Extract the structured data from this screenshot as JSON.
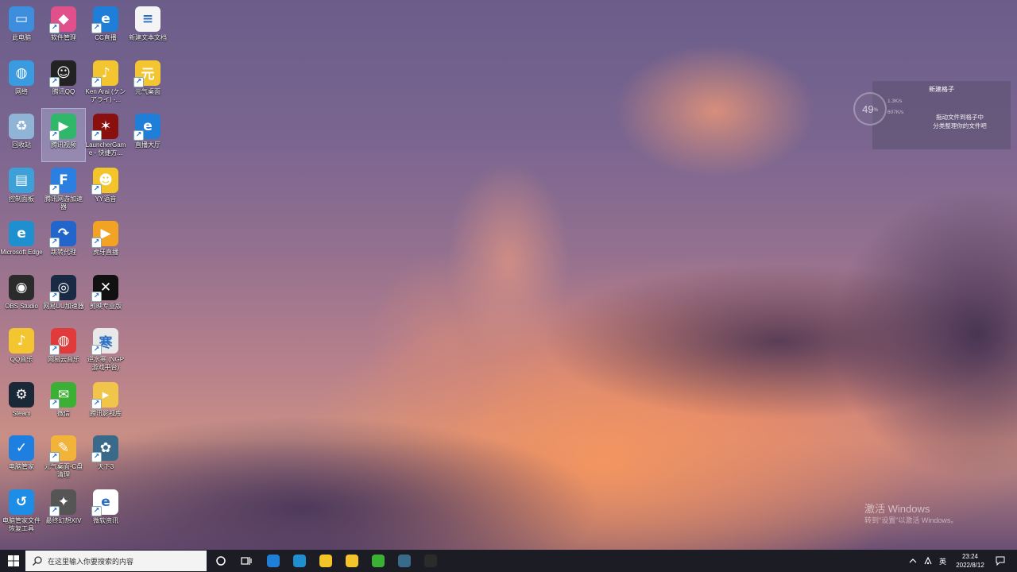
{
  "desktop": {
    "icons": [
      {
        "label": "此电脑",
        "icon": "computer-icon",
        "color": "#3d8fdd",
        "glyph": "▭",
        "shortcut": false
      },
      {
        "label": "网络",
        "icon": "network-icon",
        "color": "#3a9be0",
        "glyph": "◍",
        "shortcut": false
      },
      {
        "label": "回收站",
        "icon": "recycle-bin-icon",
        "color": "#8fb4d6",
        "glyph": "♻",
        "shortcut": false
      },
      {
        "label": "控制面板",
        "icon": "control-panel-icon",
        "color": "#3ea0d9",
        "glyph": "▤",
        "shortcut": false
      },
      {
        "label": "Microsoft Edge",
        "icon": "edge-icon",
        "color": "#1f8fd0",
        "glyph": "e",
        "shortcut": false
      },
      {
        "label": "OBS Studio",
        "icon": "obs-icon",
        "color": "#2b2b2b",
        "glyph": "◉",
        "shortcut": false
      },
      {
        "label": "QQ音乐",
        "icon": "qq-music-icon",
        "color": "#f2c531",
        "glyph": "♪",
        "shortcut": false
      },
      {
        "label": "Steam",
        "icon": "steam-icon",
        "color": "#1b2838",
        "glyph": "⚙",
        "shortcut": false
      },
      {
        "label": "电脑管家",
        "icon": "pc-manager-icon",
        "color": "#1e7fe0",
        "glyph": "✓",
        "shortcut": false
      },
      {
        "label": "电脑管家文件恢复工具",
        "icon": "file-recovery-icon",
        "color": "#1e8de6",
        "glyph": "↺",
        "shortcut": false
      },
      {
        "label": "软件管理",
        "icon": "software-manager-icon",
        "color": "#e0508a",
        "glyph": "◆",
        "shortcut": true
      },
      {
        "label": "腾讯QQ",
        "icon": "qq-icon",
        "color": "#222222",
        "glyph": "☺",
        "shortcut": true
      },
      {
        "label": "腾讯视频",
        "icon": "tencent-video-icon",
        "color": "#2fb86a",
        "glyph": "▶",
        "shortcut": true
      },
      {
        "label": "腾讯网游加速器",
        "icon": "game-accelerator-icon",
        "color": "#2a7fe0",
        "glyph": "F",
        "shortcut": true
      },
      {
        "label": "跳转代理",
        "icon": "proxy-icon",
        "color": "#2266cc",
        "glyph": "↷",
        "shortcut": true
      },
      {
        "label": "网易UU加速器",
        "icon": "uu-accelerator-icon",
        "color": "#1a2a44",
        "glyph": "◎",
        "shortcut": true
      },
      {
        "label": "网易云音乐",
        "icon": "netease-music-icon",
        "color": "#e03a3a",
        "glyph": "◍",
        "shortcut": true
      },
      {
        "label": "微信",
        "icon": "wechat-icon",
        "color": "#3cb035",
        "glyph": "✉",
        "shortcut": true
      },
      {
        "label": "元气桌面-C盘清理",
        "icon": "c-drive-cleanup-icon",
        "color": "#f2b33a",
        "glyph": "✎",
        "shortcut": true
      },
      {
        "label": "最终幻想XIV",
        "icon": "ffxiv-icon",
        "color": "#555555",
        "glyph": "✦",
        "shortcut": true
      },
      {
        "label": "CC直播",
        "icon": "cc-live-icon",
        "color": "#1f7fd8",
        "glyph": "e",
        "shortcut": true
      },
      {
        "label": "Ken Arai (ケン アライ) -...",
        "icon": "qq-music-shortcut-icon",
        "color": "#f2c531",
        "glyph": "♪",
        "shortcut": true
      },
      {
        "label": "LauncherGame - 快捷方...",
        "icon": "launcher-game-icon",
        "color": "#8a1010",
        "glyph": "✶",
        "shortcut": true
      },
      {
        "label": "YY语音",
        "icon": "yy-voice-icon",
        "color": "#f3c52a",
        "glyph": "☻",
        "shortcut": true
      },
      {
        "label": "虎牙直播",
        "icon": "huya-live-icon",
        "color": "#f3a323",
        "glyph": "▶",
        "shortcut": true
      },
      {
        "label": "剪映专业版",
        "icon": "capcut-icon",
        "color": "#111111",
        "glyph": "✕",
        "shortcut": true
      },
      {
        "label": "逆水寒 (NGP游戏平台)",
        "icon": "nishuihan-icon",
        "color": "#e8e8e8",
        "glyph": "寒",
        "shortcut": true
      },
      {
        "label": "腾讯影视库",
        "icon": "video-library-icon",
        "color": "#f1c44a",
        "glyph": "▸",
        "shortcut": true
      },
      {
        "label": "天下3",
        "icon": "tianxia3-icon",
        "color": "#3a6a8a",
        "glyph": "✿",
        "shortcut": true
      },
      {
        "label": "微软资讯",
        "icon": "msn-news-icon",
        "color": "#ffffff",
        "glyph": "e",
        "shortcut": true
      },
      {
        "label": "新建文本文档",
        "icon": "text-document-icon",
        "color": "#f4f4f4",
        "glyph": "≡",
        "shortcut": false
      },
      {
        "label": "元气桌面",
        "icon": "yuanqi-desktop-icon",
        "color": "#f2c531",
        "glyph": "元",
        "shortcut": true
      },
      {
        "label": "直播大厅",
        "icon": "live-hall-icon",
        "color": "#1f7fd8",
        "glyph": "e",
        "shortcut": true
      }
    ],
    "selected_label": "腾讯视频"
  },
  "widget": {
    "title": "新建格子",
    "desc_line1": "拖动文件到格子中",
    "desc_line2": "分类整理你的文件吧",
    "gauge_value": "49",
    "gauge_unit": "%",
    "net_up": "1.3K/s",
    "net_down": "607K/s"
  },
  "watermark": {
    "title": "激活 Windows",
    "subtitle": "转到\"设置\"以激活 Windows。"
  },
  "taskbar": {
    "search_placeholder": "在这里输入你要搜索的内容",
    "pinned": [
      {
        "icon": "cc-live-icon",
        "color": "#1f7fd8"
      },
      {
        "icon": "edge-icon",
        "color": "#1f8fd0"
      },
      {
        "icon": "yy-voice-icon",
        "color": "#f3c52a"
      },
      {
        "icon": "yy-voice-icon",
        "color": "#f3c52a"
      },
      {
        "icon": "wechat-icon",
        "color": "#3cb035"
      },
      {
        "icon": "tianxia3-icon",
        "color": "#3a6a8a"
      },
      {
        "icon": "obs-icon",
        "color": "#2b2b2b"
      }
    ],
    "ime": "英",
    "time": "23:24",
    "date": "2022/8/12"
  }
}
